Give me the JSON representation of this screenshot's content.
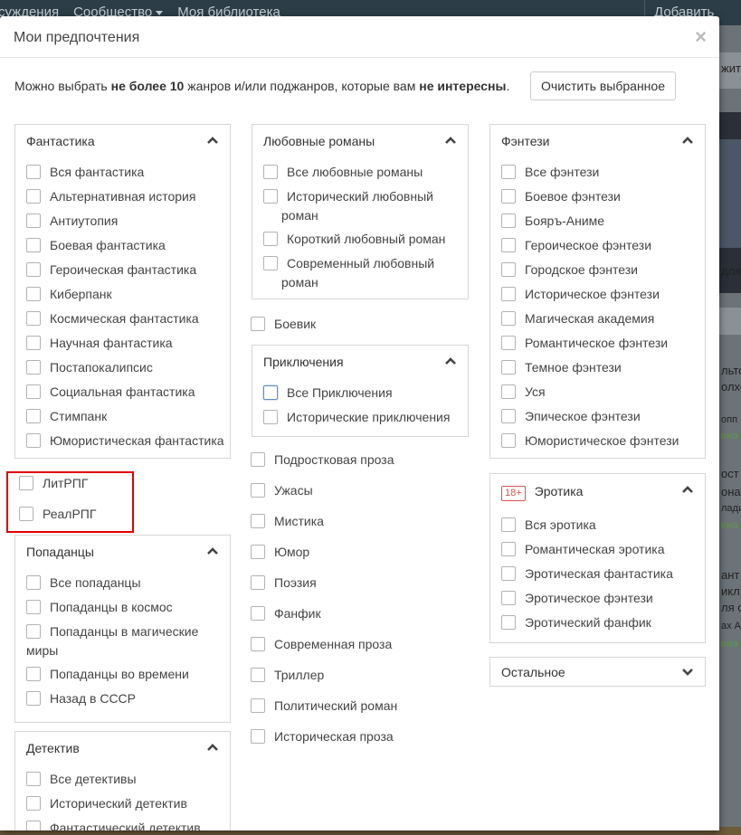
{
  "backdrop": {
    "nav": [
      "суждения",
      "Сообщество",
      "Моя библиотека"
    ],
    "add_label": "Добавить",
    "side_texts": [
      "жит",
      "для",
      "льто",
      "олхо",
      "опп",
      "ена",
      "ост",
      "она",
      "лади",
      "ена",
      "ант",
      "икл",
      "ля с",
      "ах А",
      "ена"
    ]
  },
  "modal": {
    "title": "Мои предпочтения",
    "close": "×",
    "intro_pre": "Можно выбрать ",
    "intro_bold1": "не более 10",
    "intro_mid": " жанров и/или поджанров, которые вам ",
    "intro_bold2": "не интересны",
    "intro_post": ".",
    "clear_button": "Очистить выбранное"
  },
  "col1": {
    "fantastika": {
      "title": "Фантастика",
      "items": [
        "Вся фантастика",
        "Альтернативная история",
        "Антиутопия",
        "Боевая фантастика",
        "Героическая фантастика",
        "Киберпанк",
        "Космическая фантастика",
        "Научная фантастика",
        "Постапокалипсис",
        "Социальная фантастика",
        "Стимпанк",
        "Юмористическая фантастика"
      ]
    },
    "litrpg": "ЛитРПГ",
    "realrpg": "РеалРПГ",
    "popadantsy": {
      "title": "Попаданцы",
      "items": [
        "Все попаданцы",
        "Попаданцы в космос",
        "Попаданцы в магические",
        "миры",
        "Попаданцы во времени",
        "Назад в СССР"
      ]
    },
    "detektiv": {
      "title": "Детектив",
      "items": [
        "Все детективы",
        "Исторический детектив",
        "Фантастический детектив"
      ]
    }
  },
  "col2": {
    "lyubovnye": {
      "title": "Любовные романы",
      "items": [
        "Все любовные романы",
        "Исторический любовный",
        "роман",
        "Короткий любовный роман",
        "Современный любовный",
        "роман"
      ]
    },
    "boevik": "Боевик",
    "priklyucheniya": {
      "title": "Приключения",
      "items": [
        "Все Приключения",
        "Исторические приключения"
      ]
    },
    "standalone": [
      "Подростковая проза",
      "Ужасы",
      "Мистика",
      "Юмор",
      "Поэзия",
      "Фанфик",
      "Современная проза",
      "Триллер",
      "Политический роман",
      "Историческая проза"
    ]
  },
  "col3": {
    "fentezi": {
      "title": "Фэнтези",
      "items": [
        "Все фэнтези",
        "Боевое фэнтези",
        "Бояръ-Аниме",
        "Героическое фэнтези",
        "Городское фэнтези",
        "Историческое фэнтези",
        "Магическая академия",
        "Романтическое фэнтези",
        "Темное фэнтези",
        "Уся",
        "Эпическое фэнтези",
        "Юмористическое фэнтези"
      ]
    },
    "erotika": {
      "badge": "18+",
      "title": "Эротика",
      "items": [
        "Вся эротика",
        "Романтическая эротика",
        "Эротическая фантастика",
        "Эротическое фэнтези",
        "Эротический фанфик"
      ]
    },
    "ostalnoe": {
      "title": "Остальное"
    }
  }
}
